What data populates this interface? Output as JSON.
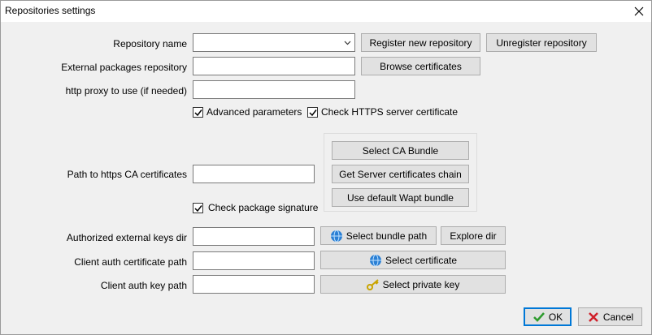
{
  "window": {
    "title": "Repositories settings",
    "close_icon": "close-icon"
  },
  "fields": {
    "repository_name_label": "Repository name",
    "external_repo_label": "External packages repository",
    "http_proxy_label": "http proxy to use (if needed)",
    "path_ca_label": "Path to https CA certificates",
    "authorized_keys_label": "Authorized external keys dir",
    "client_cert_label": "Client auth certificate path",
    "client_key_label": "Client auth key path"
  },
  "buttons": {
    "register": "Register new repository",
    "unregister": "Unregister repository",
    "browse_certs": "Browse certificates",
    "select_ca": "Select CA Bundle",
    "get_chain": "Get Server certificates chain",
    "use_default": "Use default Wapt bundle",
    "select_bundle": "Select bundle path",
    "explore_dir": "Explore dir",
    "select_cert": "Select certificate",
    "select_key": "Select private key",
    "ok": "OK",
    "cancel": "Cancel"
  },
  "checkboxes": {
    "advanced": {
      "label": "Advanced parameters",
      "checked": true
    },
    "check_https": {
      "label": "Check HTTPS server certificate",
      "checked": true
    },
    "check_signature": {
      "label": "Check package signature",
      "checked": true
    }
  },
  "colors": {
    "ok_check": "#2e9b2e",
    "cancel_x": "#d0202a",
    "globe": "#2a7fd4"
  }
}
